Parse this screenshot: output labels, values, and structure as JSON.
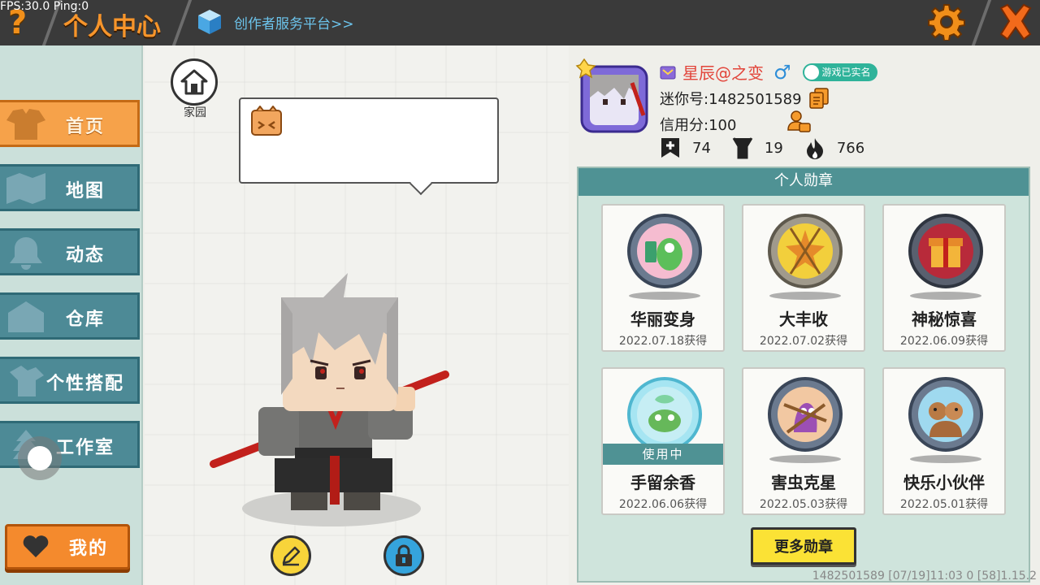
{
  "debug": {
    "fps_text": "FPS:30.0  Ping:0"
  },
  "header": {
    "help_icon": "?",
    "title": "个人中心",
    "creator_link": "创作者服务平台>>",
    "settings_icon": "gear-icon",
    "close_icon": "close-icon"
  },
  "sidebar": {
    "items": [
      {
        "label": "首页",
        "icon": "shirt-icon",
        "active": true
      },
      {
        "label": "地图",
        "icon": "map-icon",
        "active": false
      },
      {
        "label": "动态",
        "icon": "bell-icon",
        "active": false
      },
      {
        "label": "仓库",
        "icon": "warehouse-icon",
        "active": false
      },
      {
        "label": "个性搭配",
        "icon": "outfit-icon",
        "active": false
      },
      {
        "label": "工作室",
        "icon": "tree-icon",
        "active": false
      }
    ],
    "mine_button": "我的"
  },
  "stage": {
    "home_label": "家园"
  },
  "profile": {
    "nickname": "星辰@之变",
    "gender_symbol": "♂",
    "realname_badge": "游戏已实名",
    "mini_id": "迷你号:1482501589",
    "credit": "信用分:100",
    "stats": [
      {
        "icon": "bookmark-plus-icon",
        "value": "74"
      },
      {
        "icon": "cheer-icon",
        "value": "19"
      },
      {
        "icon": "flame-icon",
        "value": "766"
      }
    ]
  },
  "medals": {
    "title": "个人勋章",
    "items": [
      {
        "name": "华丽变身",
        "date": "2022.07.18获得",
        "in_use": false,
        "color": "#7bbcd2"
      },
      {
        "name": "大丰收",
        "date": "2022.07.02获得",
        "in_use": false,
        "color": "#e9c64a"
      },
      {
        "name": "神秘惊喜",
        "date": "2022.06.09获得",
        "in_use": false,
        "color": "#b3314a"
      },
      {
        "name": "手留余香",
        "date": "2022.06.06获得",
        "in_use": true,
        "color": "#8fd6e6"
      },
      {
        "name": "害虫克星",
        "date": "2022.05.03获得",
        "in_use": false,
        "color": "#b76fc4"
      },
      {
        "name": "快乐小伙伴",
        "date": "2022.05.01获得",
        "in_use": false,
        "color": "#7ec8e8"
      }
    ],
    "in_use_label": "使用中",
    "more_button": "更多勋章"
  },
  "footer": {
    "info": "1482501589   [07/19]11:03 0  [58]1.15.2"
  }
}
